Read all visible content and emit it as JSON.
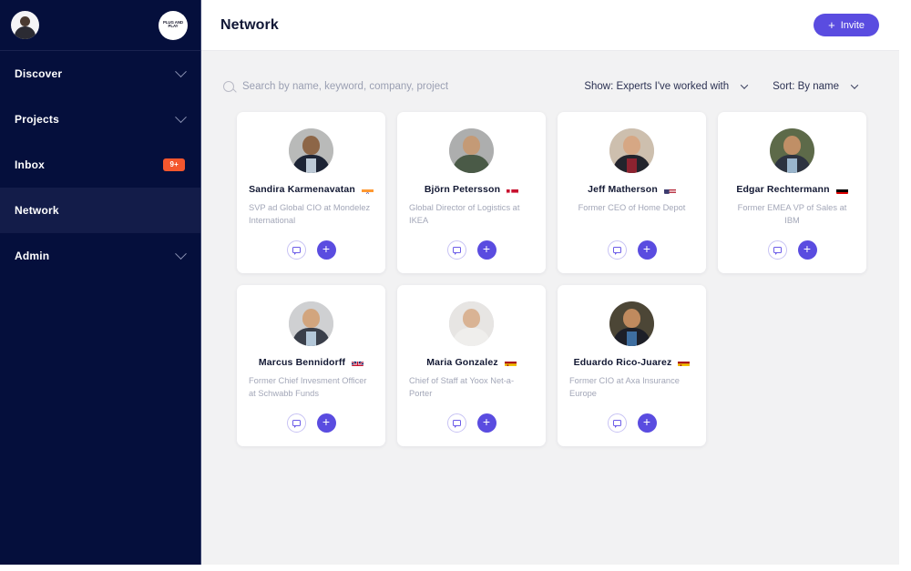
{
  "sidebar": {
    "brand_logo_text": "PLUG AND PLAY",
    "avatar_name": "user-avatar",
    "items": [
      {
        "label": "Discover",
        "icon": "chevron-down-icon",
        "active": false,
        "badge": null
      },
      {
        "label": "Projects",
        "icon": "chevron-down-icon",
        "active": false,
        "badge": null
      },
      {
        "label": "Inbox",
        "icon": null,
        "active": false,
        "badge": "9+"
      },
      {
        "label": "Network",
        "icon": null,
        "active": true,
        "badge": null
      },
      {
        "label": "Admin",
        "icon": "chevron-down-icon",
        "active": false,
        "badge": null
      }
    ]
  },
  "header": {
    "title": "Network",
    "invite_label": "Invite",
    "invite_icon": "plus-icon"
  },
  "toolbar": {
    "search_placeholder": "Search by name, keyword, company, project",
    "search_value": "",
    "search_icon": "search-icon",
    "filters": [
      {
        "label": "Show: Experts I've worked with",
        "icon": "chevron-down-icon"
      },
      {
        "label": "Sort: By name",
        "icon": "chevron-down-icon"
      }
    ]
  },
  "colors": {
    "sidebar_bg": "#050f3c",
    "sidebar_active": "#131c49",
    "accent": "#5a4ce0",
    "badge": "#f4572e",
    "page_bg": "#f2f2f3",
    "card_bg": "#ffffff",
    "role_text": "#a3a7b8"
  },
  "cards": [
    {
      "name": "Sandira Karmenavatan",
      "role": "SVP ad Global CIO at Mondelez International",
      "flag": "in",
      "flag_label": "flag-india",
      "role_center": false,
      "chat_label": "message",
      "add_label": "add",
      "portrait": {
        "bg": "#b9bab9",
        "skin": "#8d6647",
        "body": "#1d2435",
        "shirt": "#bcc9d6"
      }
    },
    {
      "name": "Björn Petersson",
      "role": "Global Director of Logistics at IKEA",
      "flag": "dk",
      "flag_label": "flag-denmark",
      "role_center": false,
      "chat_label": "message",
      "add_label": "add",
      "portrait": {
        "bg": "#adaeae",
        "skin": "#c49a76",
        "body": "#4a5a47",
        "shirt": "#4a5a47"
      }
    },
    {
      "name": "Jeff Matherson",
      "role": "Former CEO of Home Depot",
      "flag": "us",
      "flag_label": "flag-united-states",
      "role_center": true,
      "chat_label": "message",
      "add_label": "add",
      "portrait": {
        "bg": "#cdbfae",
        "skin": "#d6a784",
        "body": "#23242c",
        "shirt": "#8e2330"
      }
    },
    {
      "name": "Edgar Rechtermann",
      "role": "Former EMEA VP of Sales at IBM",
      "flag": "de",
      "flag_label": "flag-germany",
      "role_center": true,
      "chat_label": "message",
      "add_label": "add",
      "portrait": {
        "bg": "#5d6a49",
        "skin": "#c08f66",
        "body": "#2d3340",
        "shirt": "#9ab5cc"
      }
    },
    {
      "name": "Marcus Bennidorff",
      "role": "Former Chief Invesment Officer at Schwabb Funds",
      "flag": "gb",
      "flag_label": "flag-united-kingdom",
      "role_center": false,
      "chat_label": "message",
      "add_label": "add",
      "portrait": {
        "bg": "#cfd0d2",
        "skin": "#d2a57e",
        "body": "#3a3f4a",
        "shirt": "#b3c7d8"
      }
    },
    {
      "name": "Maria Gonzalez",
      "role": "Chief of Staff at Yoox Net-a-Porter",
      "flag": "es",
      "flag_label": "flag-spain",
      "role_center": false,
      "chat_label": "message",
      "add_label": "add",
      "portrait": {
        "bg": "#e7e5e3",
        "skin": "#d9b394",
        "body": "#efeeec",
        "shirt": "#efeeec"
      }
    },
    {
      "name": "Eduardo Rico-Juarez",
      "role": "Former CIO at Axa Insurance Europe",
      "flag": "es",
      "flag_label": "flag-spain",
      "role_center": false,
      "chat_label": "message",
      "add_label": "add",
      "portrait": {
        "bg": "#4c4636",
        "skin": "#c08a5e",
        "body": "#1d1f28",
        "shirt": "#3e6ea0"
      }
    }
  ]
}
